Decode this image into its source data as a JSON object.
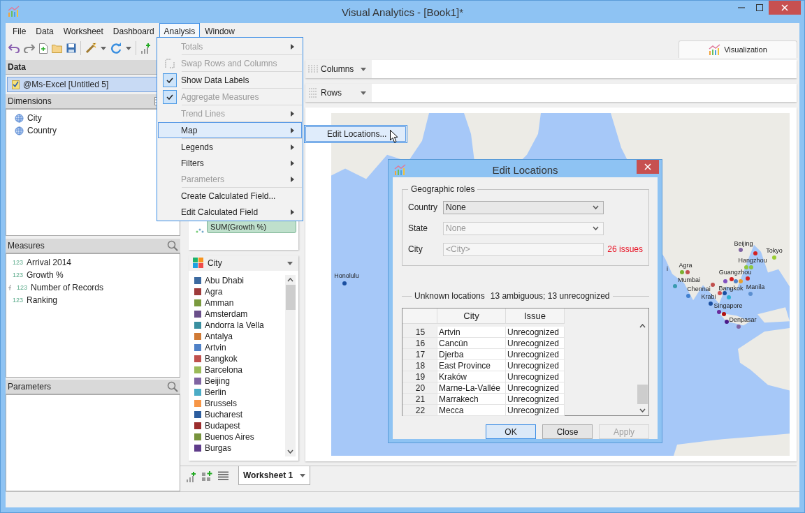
{
  "window": {
    "title": "Visual Analytics - [Book1]*"
  },
  "menu_bar": [
    {
      "label": "File",
      "selected": false
    },
    {
      "label": "Data",
      "selected": false
    },
    {
      "label": "Worksheet",
      "selected": false
    },
    {
      "label": "Dashboard",
      "selected": false
    },
    {
      "label": "Analysis",
      "selected": true
    },
    {
      "label": "Window",
      "selected": false
    }
  ],
  "analysis_menu": {
    "items": [
      {
        "label": "Totals",
        "disabled": true,
        "checked": false,
        "submenu": true,
        "selected": false,
        "has_icon": false,
        "separator_after": true
      },
      {
        "label": "Swap Rows and Columns",
        "disabled": true,
        "checked": false,
        "submenu": false,
        "selected": false,
        "has_icon": true,
        "separator_after": true
      },
      {
        "label": "Show Data Labels",
        "disabled": false,
        "checked": true,
        "submenu": false,
        "selected": false,
        "has_icon": false,
        "separator_after": true
      },
      {
        "label": "Aggregate Measures",
        "disabled": true,
        "checked": true,
        "submenu": false,
        "selected": false,
        "has_icon": false,
        "separator_after": true
      },
      {
        "label": "Trend Lines",
        "disabled": true,
        "checked": false,
        "submenu": true,
        "selected": false,
        "has_icon": false,
        "separator_after": true
      },
      {
        "label": "Map",
        "disabled": false,
        "checked": false,
        "submenu": true,
        "selected": true,
        "has_icon": false,
        "separator_after": true
      },
      {
        "label": "Legends",
        "disabled": false,
        "checked": false,
        "submenu": true,
        "selected": false,
        "has_icon": false,
        "separator_after": false
      },
      {
        "label": "Filters",
        "disabled": false,
        "checked": false,
        "submenu": true,
        "selected": false,
        "has_icon": false,
        "separator_after": false
      },
      {
        "label": "Parameters",
        "disabled": true,
        "checked": false,
        "submenu": true,
        "selected": false,
        "has_icon": false,
        "separator_after": true
      },
      {
        "label": "Create Calculated Field...",
        "disabled": false,
        "checked": false,
        "submenu": false,
        "selected": false,
        "has_icon": false,
        "separator_after": false
      },
      {
        "label": "Edit Calculated Field",
        "disabled": false,
        "checked": false,
        "submenu": true,
        "selected": false,
        "has_icon": false,
        "separator_after": false
      }
    ]
  },
  "map_submenu": {
    "items": [
      {
        "label": "Edit Locations...",
        "selected": true
      }
    ]
  },
  "view_tabs": [
    {
      "label": "Visualization",
      "selected": true
    }
  ],
  "data_panel": {
    "title": "Data",
    "sources": [
      {
        "label": "@Ms-Excel [Untitled 5]",
        "selected": true
      }
    ]
  },
  "dimensions": {
    "title": "Dimensions",
    "items": [
      {
        "label": "City"
      },
      {
        "label": "Country"
      }
    ]
  },
  "measures": {
    "title": "Measures",
    "items": [
      {
        "badge": "123",
        "label": "Arrival 2014",
        "calculated": false
      },
      {
        "badge": "123",
        "label": "Growth %",
        "calculated": false
      },
      {
        "badge": "123",
        "label": "Number of Records",
        "calculated": true
      },
      {
        "badge": "123",
        "label": "Ranking",
        "calculated": false
      }
    ]
  },
  "parameters": {
    "title": "Parameters"
  },
  "marks": {
    "pill": "SUM(Growth %)"
  },
  "shelves": [
    {
      "kind": "columns",
      "label": "Columns"
    },
    {
      "kind": "rows",
      "label": "Rows"
    }
  ],
  "legend": {
    "title": "City",
    "items": [
      {
        "label": "Abu Dhabi",
        "color": "#3d6aa0"
      },
      {
        "label": "Agra",
        "color": "#9e3b3b"
      },
      {
        "label": "Amman",
        "color": "#7a9a3e"
      },
      {
        "label": "Amsterdam",
        "color": "#6a4f8a"
      },
      {
        "label": "Andorra la Vella",
        "color": "#3a8fa0"
      },
      {
        "label": "Antalya",
        "color": "#d07a35"
      },
      {
        "label": "Artvin",
        "color": "#4f81c7"
      },
      {
        "label": "Bangkok",
        "color": "#c0504d"
      },
      {
        "label": "Barcelona",
        "color": "#9bbb59"
      },
      {
        "label": "Beijing",
        "color": "#8064a2"
      },
      {
        "label": "Berlin",
        "color": "#4bacc6"
      },
      {
        "label": "Brussels",
        "color": "#f79646"
      },
      {
        "label": "Bucharest",
        "color": "#2c5d9e"
      },
      {
        "label": "Budapest",
        "color": "#9b2d2d"
      },
      {
        "label": "Buenos Aires",
        "color": "#77933c"
      },
      {
        "label": "Burgas",
        "color": "#5f3c8a"
      }
    ]
  },
  "map": {
    "labels": [
      {
        "text": "Honolulu"
      },
      {
        "text": "Beijing"
      },
      {
        "text": "Tokyo"
      },
      {
        "text": "Hangzhou"
      },
      {
        "text": "i"
      },
      {
        "text": "Agra"
      },
      {
        "text": "Guangzhou"
      },
      {
        "text": "Mumbai"
      },
      {
        "text": "Chennai"
      },
      {
        "text": "Bangkok"
      },
      {
        "text": "Manila"
      },
      {
        "text": "Krabi"
      },
      {
        "text": "Singapore"
      },
      {
        "text": "Denpasar"
      }
    ],
    "pins": [
      {
        "color": "#1a4fa0"
      },
      {
        "color": "#8064a2"
      },
      {
        "color": "#9acd32"
      },
      {
        "color": "#d42020"
      },
      {
        "color": "#8dc63f"
      },
      {
        "color": "#8dc63f"
      },
      {
        "color": "#7ab030"
      },
      {
        "color": "#c0504d"
      },
      {
        "color": "#d42020"
      },
      {
        "color": "#4f81c7"
      },
      {
        "color": "#e8a030"
      },
      {
        "color": "#d42020"
      },
      {
        "color": "#3a9ab0"
      },
      {
        "color": "#4080d0"
      },
      {
        "color": "#c0504d"
      },
      {
        "color": "#8050c0"
      },
      {
        "color": "#5b8fd0"
      },
      {
        "color": "#d05050"
      },
      {
        "color": "#1a4fa0"
      },
      {
        "color": "#30b0d0"
      },
      {
        "color": "#1a4fa0"
      },
      {
        "color": "#6a2a9a"
      },
      {
        "color": "#b01010"
      },
      {
        "color": "#4a1a8a"
      },
      {
        "color": "#8064a2"
      }
    ]
  },
  "sheet_tabs": [
    {
      "label": "Worksheet 1",
      "selected": true
    }
  ],
  "dialog": {
    "title": "Edit Locations",
    "group_title": "Geographic roles",
    "roles": [
      {
        "label": "Country",
        "kind": "dropdown",
        "value": "None",
        "disabled": false
      },
      {
        "label": "State",
        "kind": "dropdown",
        "value": "None",
        "disabled": true
      },
      {
        "label": "City",
        "kind": "field",
        "placeholder": "<City>",
        "disabled": true,
        "issues": "26 issues"
      }
    ],
    "unknown_label": "Unknown locations",
    "unknown_summary": "13 ambiguous; 13 unrecognized",
    "table": {
      "columns": [
        "City",
        "Issue"
      ],
      "rows": [
        {
          "number": "15",
          "city": "Artvin",
          "issue": "Unrecognized"
        },
        {
          "number": "16",
          "city": "Cancún",
          "issue": "Unrecognized"
        },
        {
          "number": "17",
          "city": "Djerba",
          "issue": "Unrecognized"
        },
        {
          "number": "18",
          "city": "East Province",
          "issue": "Unrecognized"
        },
        {
          "number": "19",
          "city": "Kraków",
          "issue": "Unrecognized"
        },
        {
          "number": "20",
          "city": "Marne-La-Vallée",
          "issue": "Unrecognized"
        },
        {
          "number": "21",
          "city": "Marrakech",
          "issue": "Unrecognized"
        },
        {
          "number": "22",
          "city": "Mecca",
          "issue": "Unrecognized"
        }
      ]
    },
    "buttons": [
      {
        "label": "OK",
        "default": true,
        "disabled": false
      },
      {
        "label": "Close",
        "default": false,
        "disabled": false
      },
      {
        "label": "Apply",
        "default": false,
        "disabled": true
      }
    ]
  }
}
